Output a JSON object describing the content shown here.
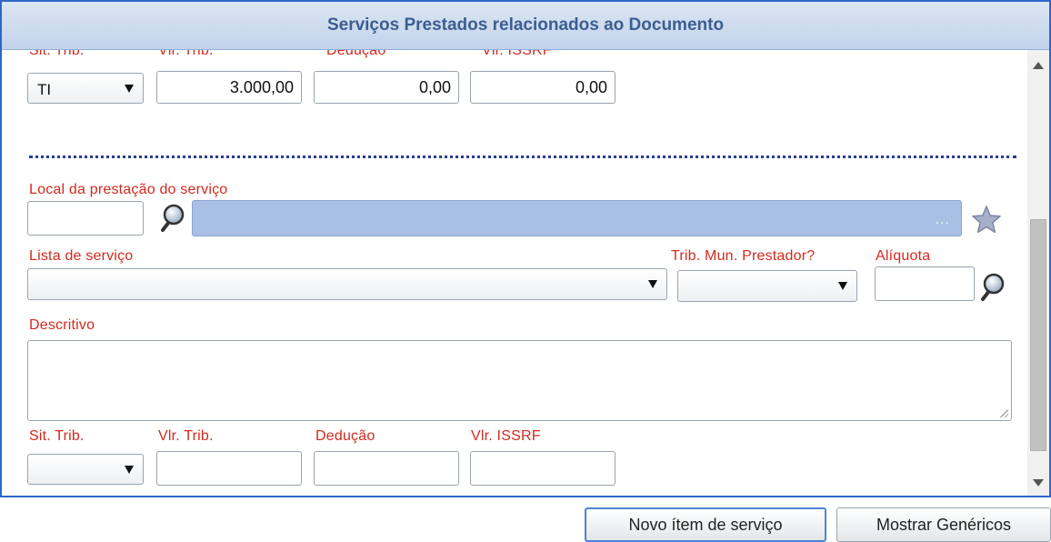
{
  "panel": {
    "title": "Serviços Prestados relacionados ao Documento"
  },
  "item1": {
    "labels": {
      "sit_trib": "Sit. Trib.",
      "vlr_trib": "Vlr. Trib.",
      "deducao": "Dedução",
      "vlr_issrf": "Vlr. ISSRF"
    },
    "sit_trib_value": "TI",
    "vlr_trib_value": "3.000,00",
    "deducao_value": "0,00",
    "vlr_issrf_value": "0,00"
  },
  "item2": {
    "local_label": "Local da prestação do serviço",
    "local_lookup_dots": "...",
    "lista_label": "Lista de serviço",
    "trib_mun_label": "Trib. Mun. Prestador?",
    "aliquota_label": "Alíquota",
    "descritivo_label": "Descritivo",
    "labels": {
      "sit_trib": "Sit. Trib.",
      "vlr_trib": "Vlr. Trib.",
      "deducao": "Dedução",
      "vlr_issrf": "Vlr. ISSRF"
    }
  },
  "buttons": {
    "novo_item": "Novo ítem de serviço",
    "mostrar_genericos": "Mostrar Genéricos"
  },
  "icons": {
    "lookup": "magnifier-icon",
    "favorite": "star-icon"
  },
  "colors": {
    "label_red": "#d22a1e",
    "accent_blue": "#2e66c7",
    "header_text": "#3b5e92",
    "lookup_field": "#a9c0e4"
  }
}
